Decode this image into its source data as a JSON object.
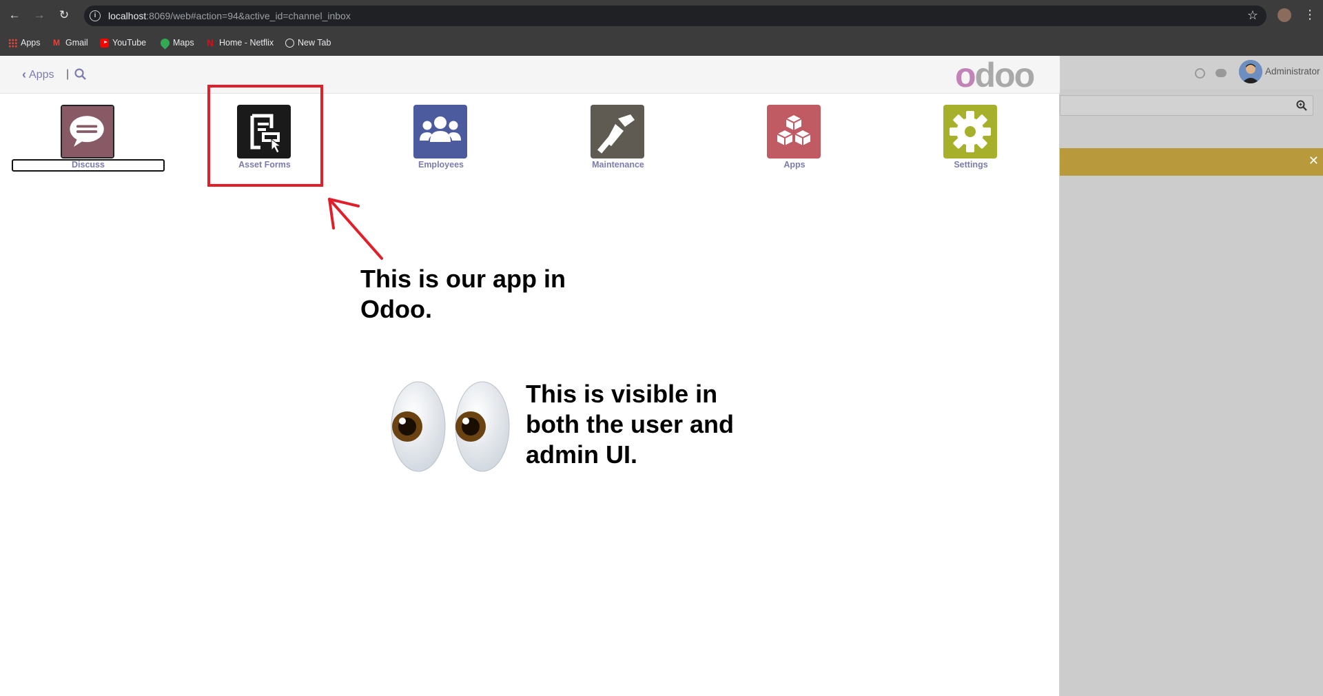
{
  "browser": {
    "url_host": "localhost",
    "url_rest": ":8069/web#action=94&active_id=channel_inbox",
    "bookmarks": [
      {
        "label": "Apps",
        "icon": "apps-grid-icon"
      },
      {
        "label": "Gmail",
        "icon": "gmail-icon"
      },
      {
        "label": "YouTube",
        "icon": "youtube-icon"
      },
      {
        "label": "Maps",
        "icon": "maps-icon"
      },
      {
        "label": "Home - Netflix",
        "icon": "netflix-icon"
      },
      {
        "label": "New Tab",
        "icon": "globe-icon"
      }
    ]
  },
  "header": {
    "back_label": "Apps",
    "separator": "|",
    "logo_first": "o",
    "logo_rest": "doo"
  },
  "apps": [
    {
      "label": "Discuss",
      "color": "#875a66"
    },
    {
      "label": "Asset Forms",
      "color": "#1a1a1a"
    },
    {
      "label": "Employees",
      "color": "#4c5a9e"
    },
    {
      "label": "Maintenance",
      "color": "#5f5a52"
    },
    {
      "label": "Apps",
      "color": "#c05a63"
    },
    {
      "label": "Settings",
      "color": "#a7b02a"
    }
  ],
  "annotations": {
    "line1_a": "This is our app in",
    "line1_b": "Odoo.",
    "line2_a": "This is visible in",
    "line2_b": "both the user and",
    "line2_c": "admin UI."
  },
  "admin": {
    "user_name": "Administrator"
  }
}
